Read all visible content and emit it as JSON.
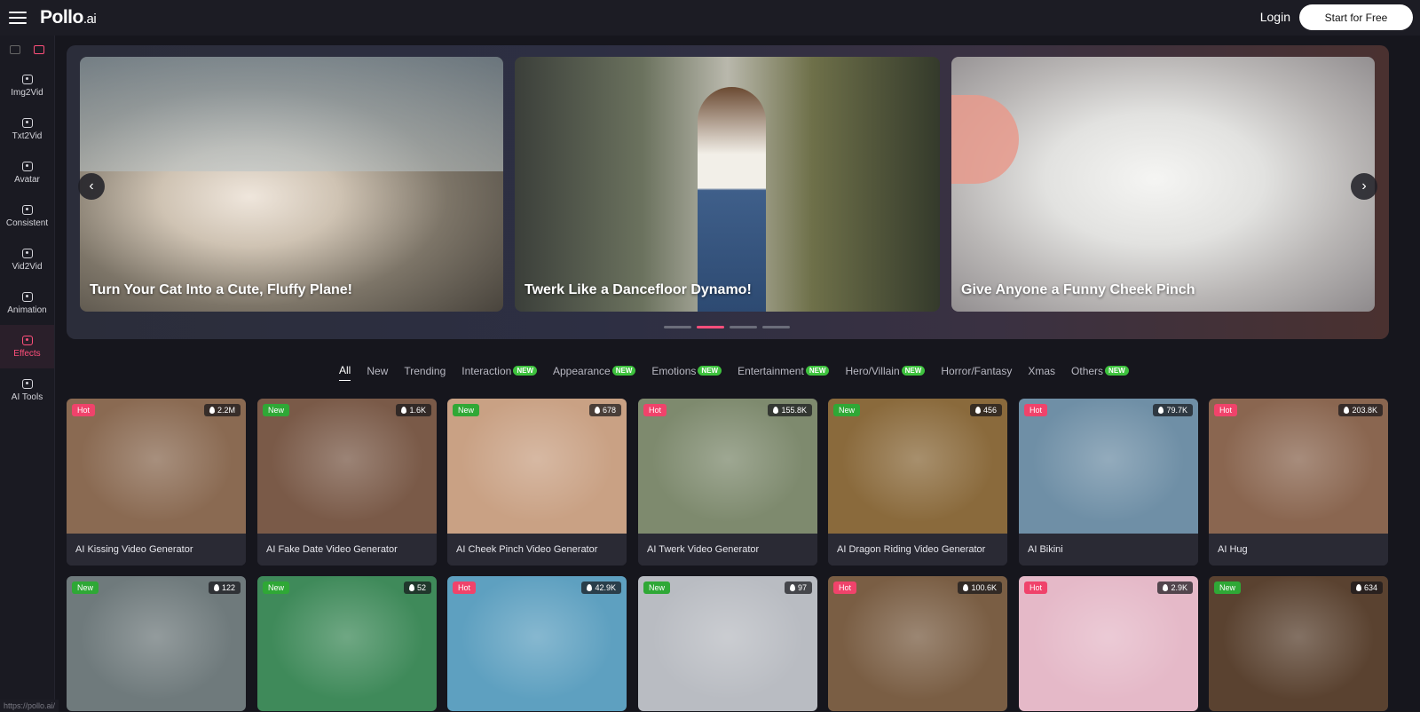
{
  "header": {
    "logo_main": "Pollo",
    "logo_suffix": ".ai",
    "login": "Login",
    "start": "Start for Free"
  },
  "sidebar": {
    "items": [
      {
        "label": "Img2Vid",
        "icon": "image-to-video-icon",
        "active": false
      },
      {
        "label": "Txt2Vid",
        "icon": "text-to-video-icon",
        "active": false
      },
      {
        "label": "Avatar",
        "icon": "avatar-icon",
        "active": false
      },
      {
        "label": "Consistent",
        "icon": "consistent-icon",
        "active": false
      },
      {
        "label": "Vid2Vid",
        "icon": "video-to-video-icon",
        "active": false
      },
      {
        "label": "Animation",
        "icon": "animation-icon",
        "active": false
      },
      {
        "label": "Effects",
        "icon": "effects-icon",
        "active": true
      },
      {
        "label": "AI Tools",
        "icon": "ai-tools-icon",
        "active": false
      }
    ]
  },
  "hero": {
    "slides": [
      {
        "caption": "Turn Your Cat Into a Cute, Fluffy Plane!"
      },
      {
        "caption": "Twerk Like a Dancefloor Dynamo!"
      },
      {
        "caption": "Give Anyone a Funny Cheek Pinch"
      }
    ],
    "prev": "‹",
    "next": "›",
    "active_dot": 1
  },
  "tabs": [
    {
      "label": "All",
      "new": false,
      "active": true
    },
    {
      "label": "New",
      "new": false
    },
    {
      "label": "Trending",
      "new": false
    },
    {
      "label": "Interaction",
      "new": true
    },
    {
      "label": "Appearance",
      "new": true
    },
    {
      "label": "Emotions",
      "new": true
    },
    {
      "label": "Entertainment",
      "new": true
    },
    {
      "label": "Hero/Villain",
      "new": true
    },
    {
      "label": "Horror/Fantasy",
      "new": false
    },
    {
      "label": "Xmas",
      "new": false
    },
    {
      "label": "Others",
      "new": true
    }
  ],
  "new_badge": "NEW",
  "cards_row1": [
    {
      "tag": "Hot",
      "views": "2.2M",
      "title": "AI Kissing Video Generator",
      "bg": "#8a6a52"
    },
    {
      "tag": "New",
      "views": "1.6K",
      "title": "AI Fake Date Video Generator",
      "bg": "#7a5a48"
    },
    {
      "tag": "New",
      "views": "678",
      "title": "AI Cheek Pinch Video Generator",
      "bg": "#c9a184"
    },
    {
      "tag": "Hot",
      "views": "155.8K",
      "title": "AI Twerk Video Generator",
      "bg": "#7e8a6e"
    },
    {
      "tag": "New",
      "views": "456",
      "title": "AI Dragon Riding Video Generator",
      "bg": "#8a6a3c"
    },
    {
      "tag": "Hot",
      "views": "79.7K",
      "title": "AI Bikini",
      "bg": "#6f8fa6"
    },
    {
      "tag": "Hot",
      "views": "203.8K",
      "title": "AI Hug",
      "bg": "#8a6650"
    }
  ],
  "cards_row2": [
    {
      "tag": "New",
      "views": "122",
      "bg": "#6f7a7c"
    },
    {
      "tag": "New",
      "views": "52",
      "bg": "#3f8a5a"
    },
    {
      "tag": "Hot",
      "views": "42.9K",
      "bg": "#5ea0c0"
    },
    {
      "tag": "New",
      "views": "97",
      "bg": "#b9bcc2"
    },
    {
      "tag": "Hot",
      "views": "100.6K",
      "bg": "#7a5e44"
    },
    {
      "tag": "Hot",
      "views": "2.9K",
      "bg": "#e5b9c8"
    },
    {
      "tag": "New",
      "views": "634",
      "bg": "#5a4230"
    }
  ],
  "status_url": "https://pollo.ai/"
}
